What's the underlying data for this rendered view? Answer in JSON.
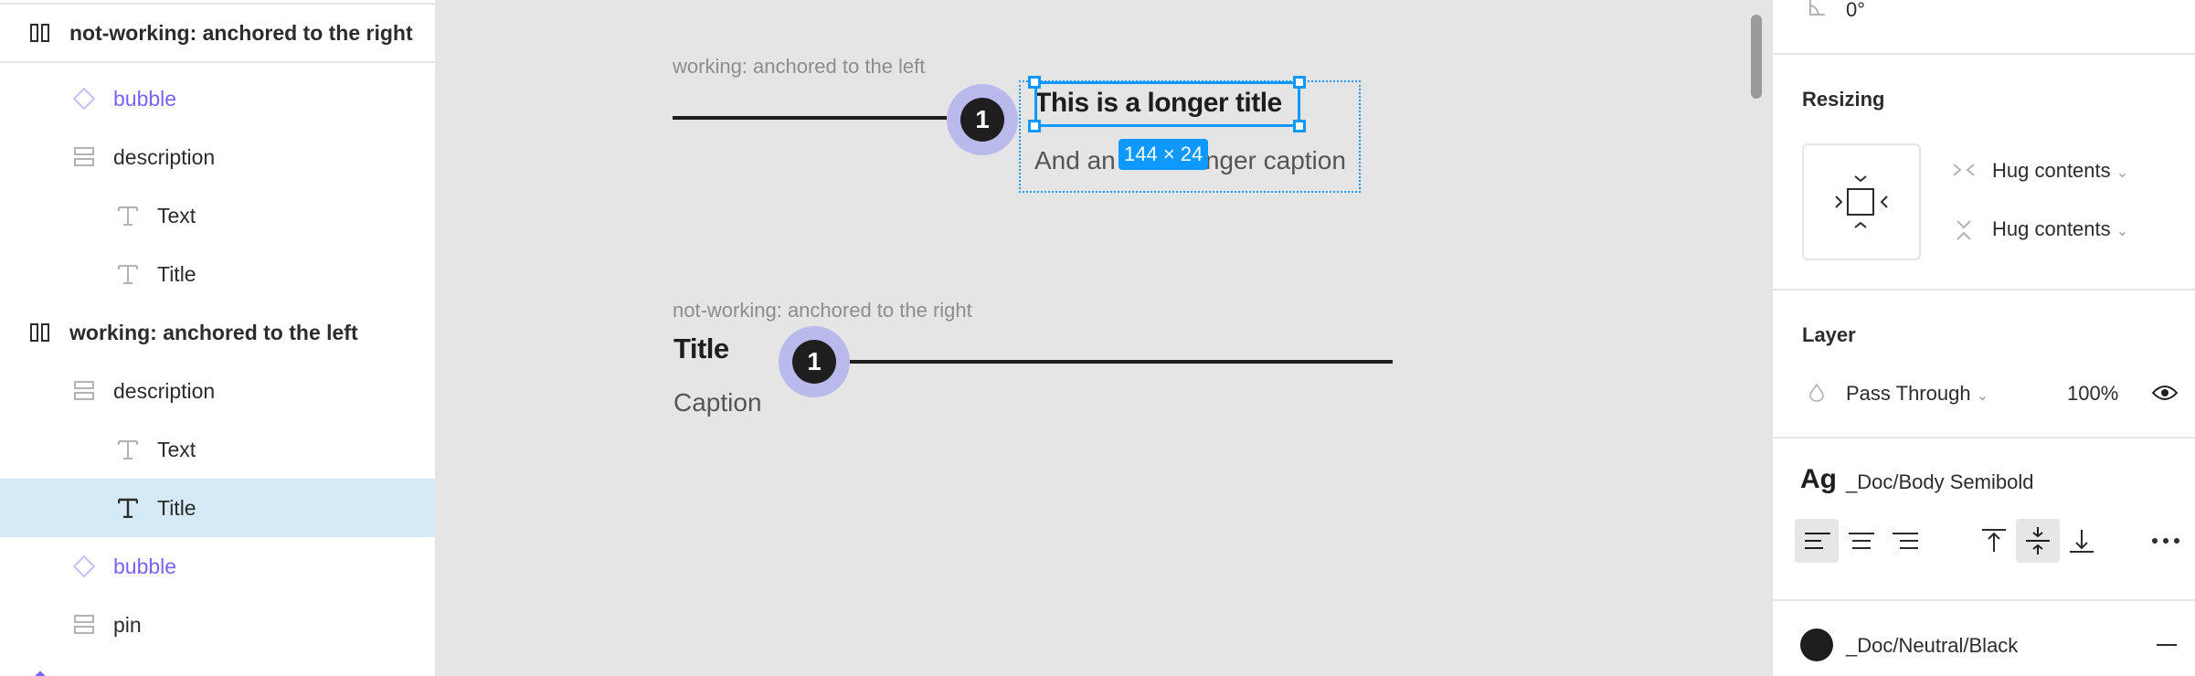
{
  "layers": {
    "rows": [
      {
        "label": "not-working: anchored to the right",
        "type": "group",
        "icon": "auto-layout-horizontal-icon"
      },
      {
        "label": "bubble",
        "type": "component",
        "icon": "component-instance-icon"
      },
      {
        "label": "description",
        "type": "frame",
        "icon": "auto-layout-vertical-icon"
      },
      {
        "label": "Text",
        "type": "text",
        "icon": "text-icon"
      },
      {
        "label": "Title",
        "type": "text",
        "icon": "text-icon"
      },
      {
        "label": "working: anchored to the left",
        "type": "group",
        "icon": "auto-layout-horizontal-icon"
      },
      {
        "label": "description",
        "type": "frame",
        "icon": "auto-layout-vertical-icon"
      },
      {
        "label": "Text",
        "type": "text",
        "icon": "text-icon"
      },
      {
        "label": "Title",
        "type": "text",
        "icon": "text-icon",
        "selected": true
      },
      {
        "label": "bubble",
        "type": "component",
        "icon": "component-instance-icon"
      },
      {
        "label": "pin",
        "type": "frame",
        "icon": "auto-layout-vertical-icon"
      }
    ]
  },
  "canvas": {
    "frame1": {
      "label": "working: anchored to the left",
      "bubble_number": "1",
      "title": "This is a longer title",
      "caption": "And an even longer caption",
      "size_badge": "144 × 24"
    },
    "frame2": {
      "label": "not-working: anchored to the right",
      "bubble_number": "1",
      "title": "Title",
      "caption": "Caption"
    }
  },
  "panel": {
    "rotation": "0°",
    "resizing": {
      "title": "Resizing",
      "width_mode": "Hug contents",
      "height_mode": "Hug contents"
    },
    "layer": {
      "title": "Layer",
      "blend_mode": "Pass Through",
      "opacity": "100%"
    },
    "text": {
      "style_preview": "Ag",
      "style_name": "_Doc/Body Semibold",
      "align_horizontal": "left",
      "align_vertical": "middle"
    },
    "fill": {
      "style_name": "_Doc/Neutral/Black",
      "color": "#1e1e1e"
    }
  },
  "colors": {
    "selection": "#0d99ff",
    "component": "#7b61ff",
    "bubble_ring": "#b9b9ec",
    "selected_row": "#d5e9f6"
  }
}
